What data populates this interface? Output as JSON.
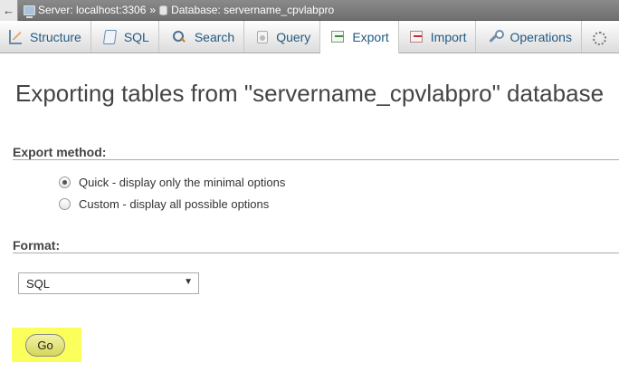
{
  "breadcrumb": {
    "back_glyph": "←",
    "server_label": "Server: localhost:3306",
    "separator": "»",
    "database_label": "Database: servername_cpvlabpro"
  },
  "tabs": [
    {
      "label": "Structure",
      "icon": "structure-icon"
    },
    {
      "label": "SQL",
      "icon": "sql-icon"
    },
    {
      "label": "Search",
      "icon": "search-icon"
    },
    {
      "label": "Query",
      "icon": "query-icon"
    },
    {
      "label": "Export",
      "icon": "export-icon",
      "active": true
    },
    {
      "label": "Import",
      "icon": "import-icon"
    },
    {
      "label": "Operations",
      "icon": "operations-icon"
    }
  ],
  "main": {
    "title": "Exporting tables from \"servername_cpvlabpro\" database",
    "export_method": {
      "label": "Export method:",
      "options": [
        {
          "label": "Quick - display only the minimal options",
          "checked": true
        },
        {
          "label": "Custom - display all possible options",
          "checked": false
        }
      ]
    },
    "format": {
      "label": "Format:",
      "selected": "SQL",
      "arrow": "▼"
    },
    "go_label": "Go"
  },
  "colors": {
    "highlight": "#fbff5c",
    "tab_text": "#235a81",
    "title_text": "#444444"
  }
}
